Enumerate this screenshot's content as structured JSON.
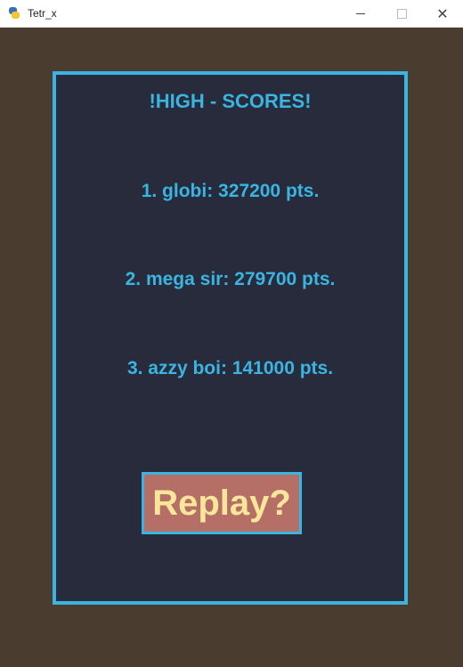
{
  "window": {
    "title": "Tetr_x",
    "icon": "pygame-snake-icon",
    "controls": [
      "minimize",
      "maximize",
      "close"
    ]
  },
  "high_scores": {
    "title": "!HIGH - SCORES!",
    "entries": [
      {
        "text": "1. globi: 327200 pts.",
        "rank": 1,
        "name": "globi",
        "points": 327200
      },
      {
        "text": "2. mega sir: 279700 pts.",
        "rank": 2,
        "name": "mega sir",
        "points": 279700
      },
      {
        "text": "3. azzy boi: 141000 pts.",
        "rank": 3,
        "name": "azzy boi",
        "points": 141000
      }
    ]
  },
  "replay": {
    "label": "Replay?"
  },
  "colors": {
    "background": "#4a3c2e",
    "panel": "#272b3c",
    "accent": "#3ab4e1",
    "button": "#b66f67",
    "button_text": "#f8e69a"
  }
}
